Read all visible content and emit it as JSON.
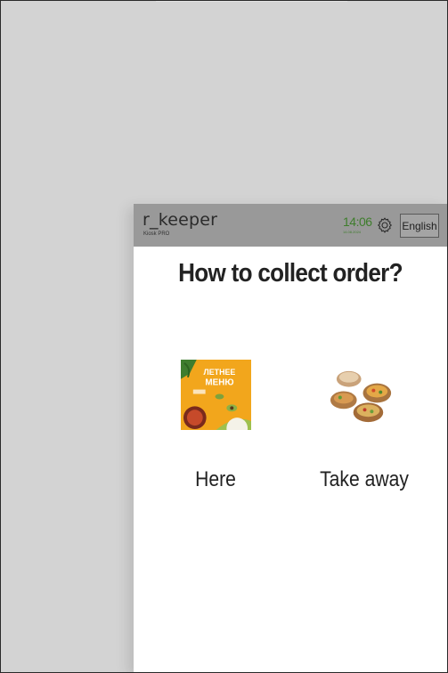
{
  "header": {
    "logo": "r_keeper",
    "logo_sub": "Kiosk PRO",
    "time": "14:06",
    "date": "14.08.2024",
    "language": "English"
  },
  "main": {
    "title": "How to collect order?",
    "options": [
      {
        "label": "Here",
        "image_text_1": "ЛЕТНЕЕ",
        "image_text_2": "МЕНЮ"
      },
      {
        "label": "Take away"
      }
    ]
  },
  "colors": {
    "background": "#d3d3d3",
    "header": "#999999",
    "clock": "#3e7d2c",
    "menu_banner": "#f2a61c"
  },
  "icons": {
    "settings": "gear-icon"
  }
}
